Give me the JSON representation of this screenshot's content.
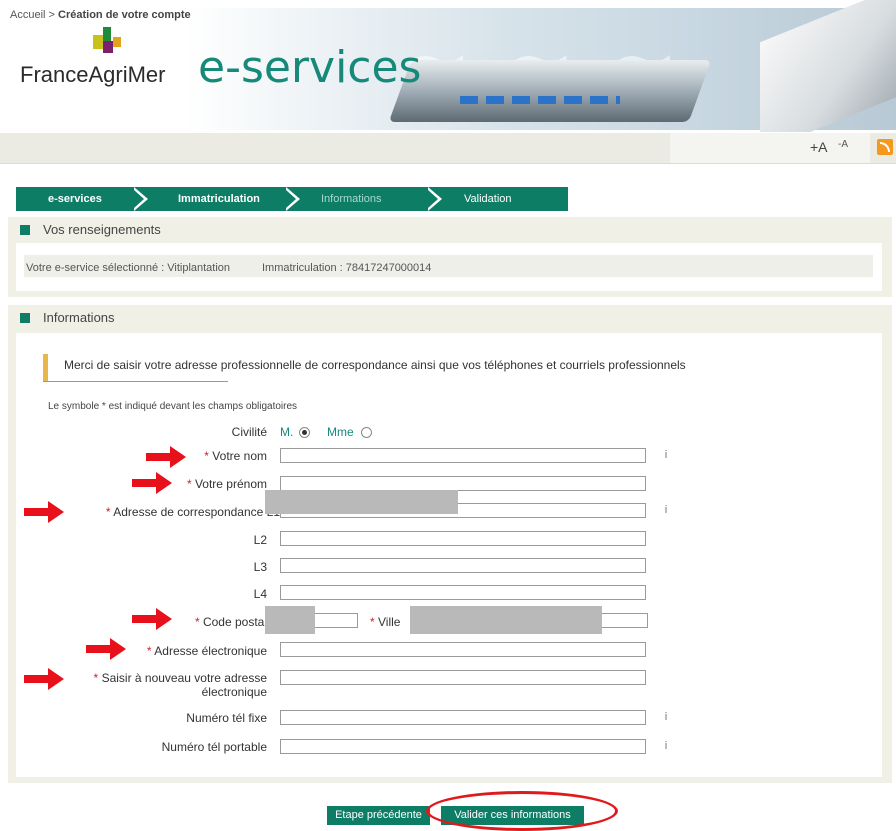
{
  "header": {
    "brand": "FranceAgriMer",
    "title": "e-services",
    "accent": "#17897b"
  },
  "breadcrumb": {
    "home": "Accueil",
    "separator": " > ",
    "current": "Création de votre compte"
  },
  "font_controls": {
    "increase": "+A",
    "decrease": "-A",
    "rss_icon": "rss-icon"
  },
  "steps": [
    {
      "label": "e-services",
      "state": "done"
    },
    {
      "label": "Immatriculation",
      "state": "done"
    },
    {
      "label": "Informations",
      "state": "current"
    },
    {
      "label": "Validation",
      "state": "todo"
    }
  ],
  "renseignements": {
    "title": "Vos renseignements",
    "eservice": "Votre e-service sélectionné : Vitiplantation",
    "immatriculation": "Immatriculation : 78417247000014"
  },
  "informations": {
    "title": "Informations",
    "message": "Merci de saisir votre adresse professionnelle de correspondance ainsi que vos téléphones et courriels professionnels",
    "note": "Le symbole * est indiqué devant les champs obligatoires",
    "civilite": {
      "label": "Civilité",
      "option_m": "M.",
      "option_mme": "Mme",
      "selected": "M."
    },
    "required_marker": "*",
    "fields": {
      "nom": "Votre nom",
      "prenom": "Votre prénom",
      "adresse_l1": "Adresse de correspondance L1",
      "l2": "L2",
      "l3": "L3",
      "l4": "L4",
      "code_postal": "Code postal",
      "ville": "Ville",
      "email": "Adresse électronique",
      "email_confirm_line1": "Saisir à nouveau votre adresse",
      "email_confirm_line2": "électronique",
      "tel_fixe": "Numéro tél fixe",
      "tel_portable": "Numéro tél portable"
    },
    "info_icon": "i"
  },
  "buttons": {
    "previous": "Etape précédente",
    "validate": "Valider ces informations"
  }
}
